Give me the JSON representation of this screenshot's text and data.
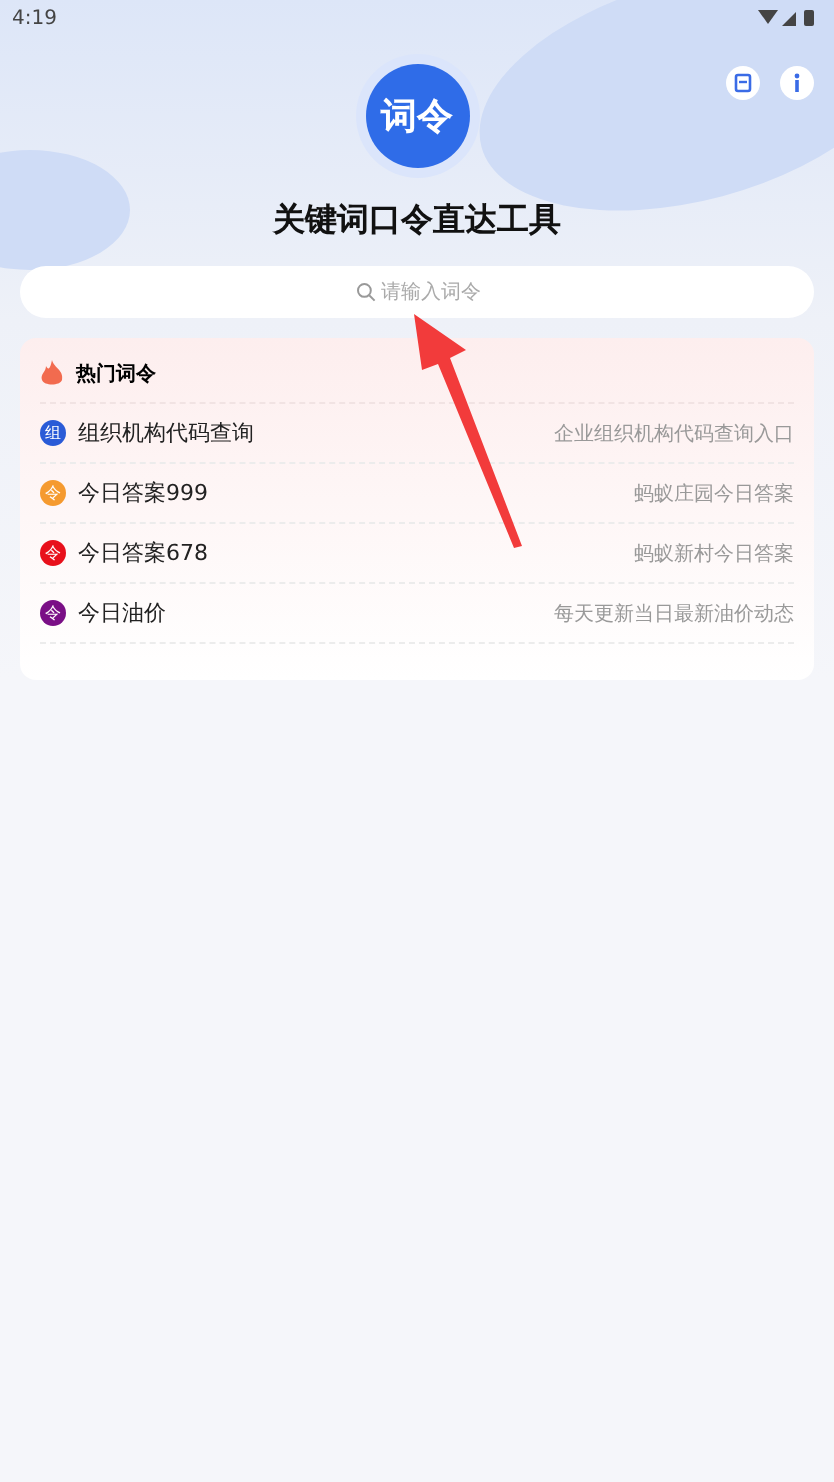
{
  "status_bar": {
    "time": "4:19"
  },
  "logo": {
    "text": "词令"
  },
  "title": "关键词口令直达工具",
  "search": {
    "placeholder": "请输入词令"
  },
  "hot": {
    "title": "热门词令",
    "items": [
      {
        "badge": "组",
        "name": "组织机构代码查询",
        "desc": "企业组织机构代码查询入口",
        "color": "#2a5bd7"
      },
      {
        "badge": "令",
        "name": "今日答案999",
        "desc": "蚂蚁庄园今日答案",
        "color": "#f59a2f"
      },
      {
        "badge": "令",
        "name": "今日答案678",
        "desc": "蚂蚁新村今日答案",
        "color": "#e8101b"
      },
      {
        "badge": "令",
        "name": "今日油价",
        "desc": "每天更新当日最新油价动态",
        "color": "#7a0f86"
      }
    ]
  }
}
